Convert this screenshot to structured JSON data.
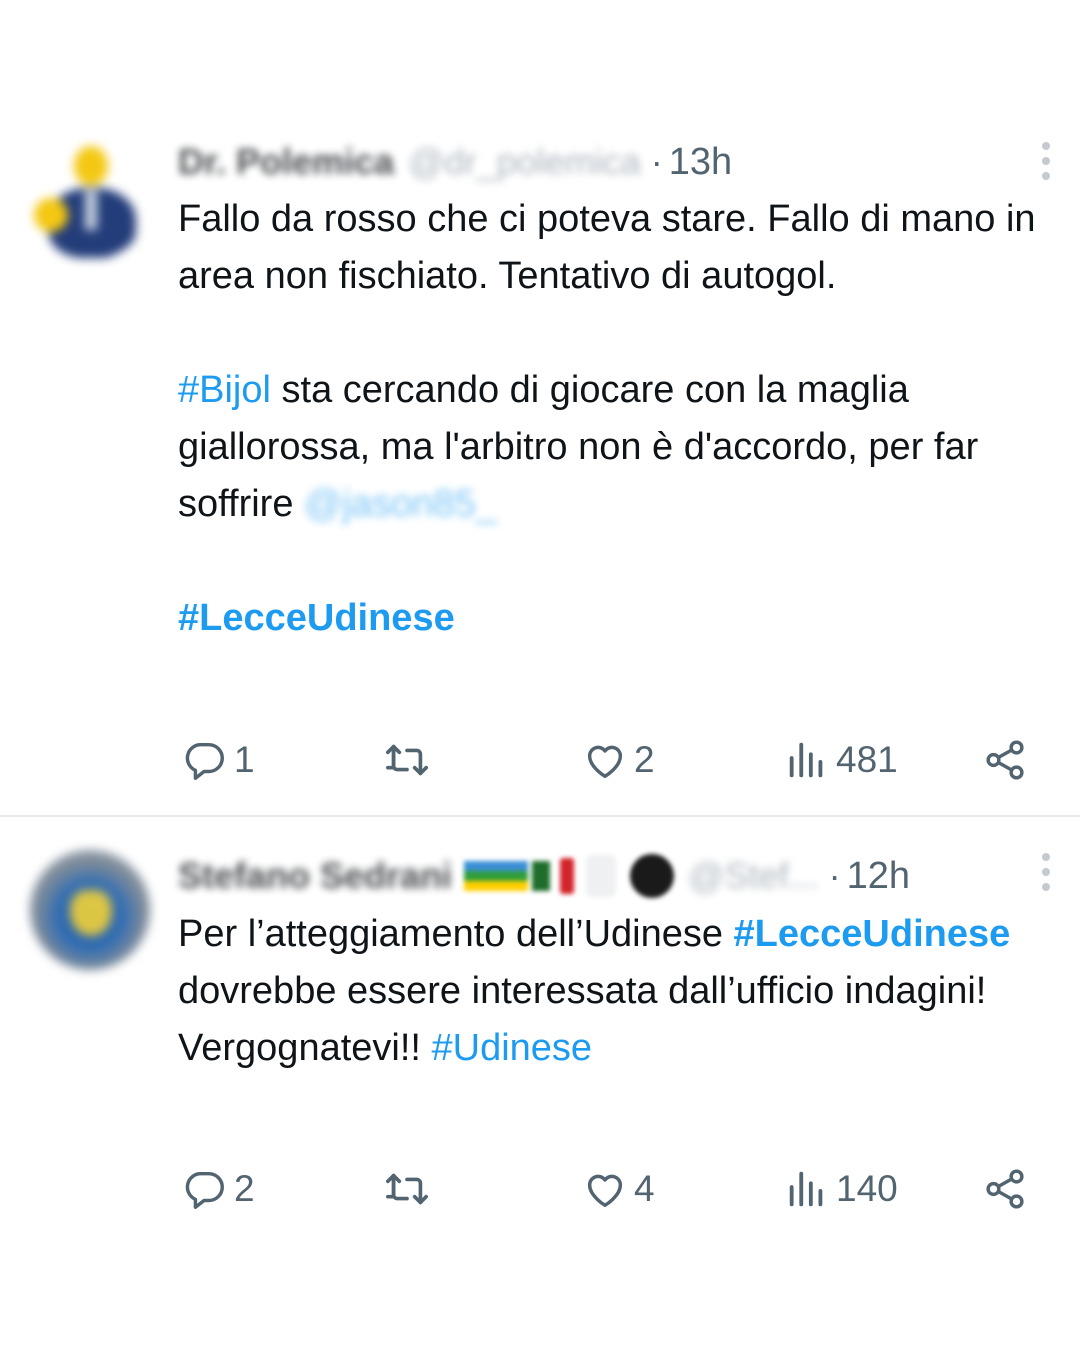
{
  "tweets": [
    {
      "author": {
        "name": "Dr. Polemica",
        "handle": "@dr_polemica"
      },
      "separator": "·",
      "time": "13h",
      "text": {
        "line1": "Fallo da rosso che ci poteva stare. Fallo di mano in area non fischiato. Tentativo di autogol.",
        "hashtag_bijol": "#Bijol",
        "line2": " sta cercando di giocare con la maglia giallorossa, ma l'arbitro non è d'accordo, per far soffrire ",
        "mention": "@jason85_",
        "hashtag_match": "#LecceUdinese"
      },
      "actions": {
        "replies": "1",
        "reposts": "",
        "likes": "2",
        "views": "481"
      }
    },
    {
      "author": {
        "name": "Stefano Sedrani",
        "handle": "@Stef..."
      },
      "separator": "·",
      "time": "12h",
      "text": {
        "line1": "Per l’atteggiamento dell’Udinese ",
        "hashtag_match": "#LecceUdinese",
        "line2": " dovrebbe essere interessata dall’ufficio indagini! Vergognatevi!! ",
        "hashtag_team": "#Udinese"
      },
      "actions": {
        "replies": "2",
        "reposts": "",
        "likes": "4",
        "views": "140"
      }
    }
  ],
  "colors": {
    "link": "#1d9bf0",
    "text": "#0f1419",
    "muted": "#536471",
    "divider": "#e7e9ea"
  },
  "icons": [
    "reply-icon",
    "repost-icon",
    "like-icon",
    "views-icon",
    "share-icon",
    "more-icon"
  ]
}
